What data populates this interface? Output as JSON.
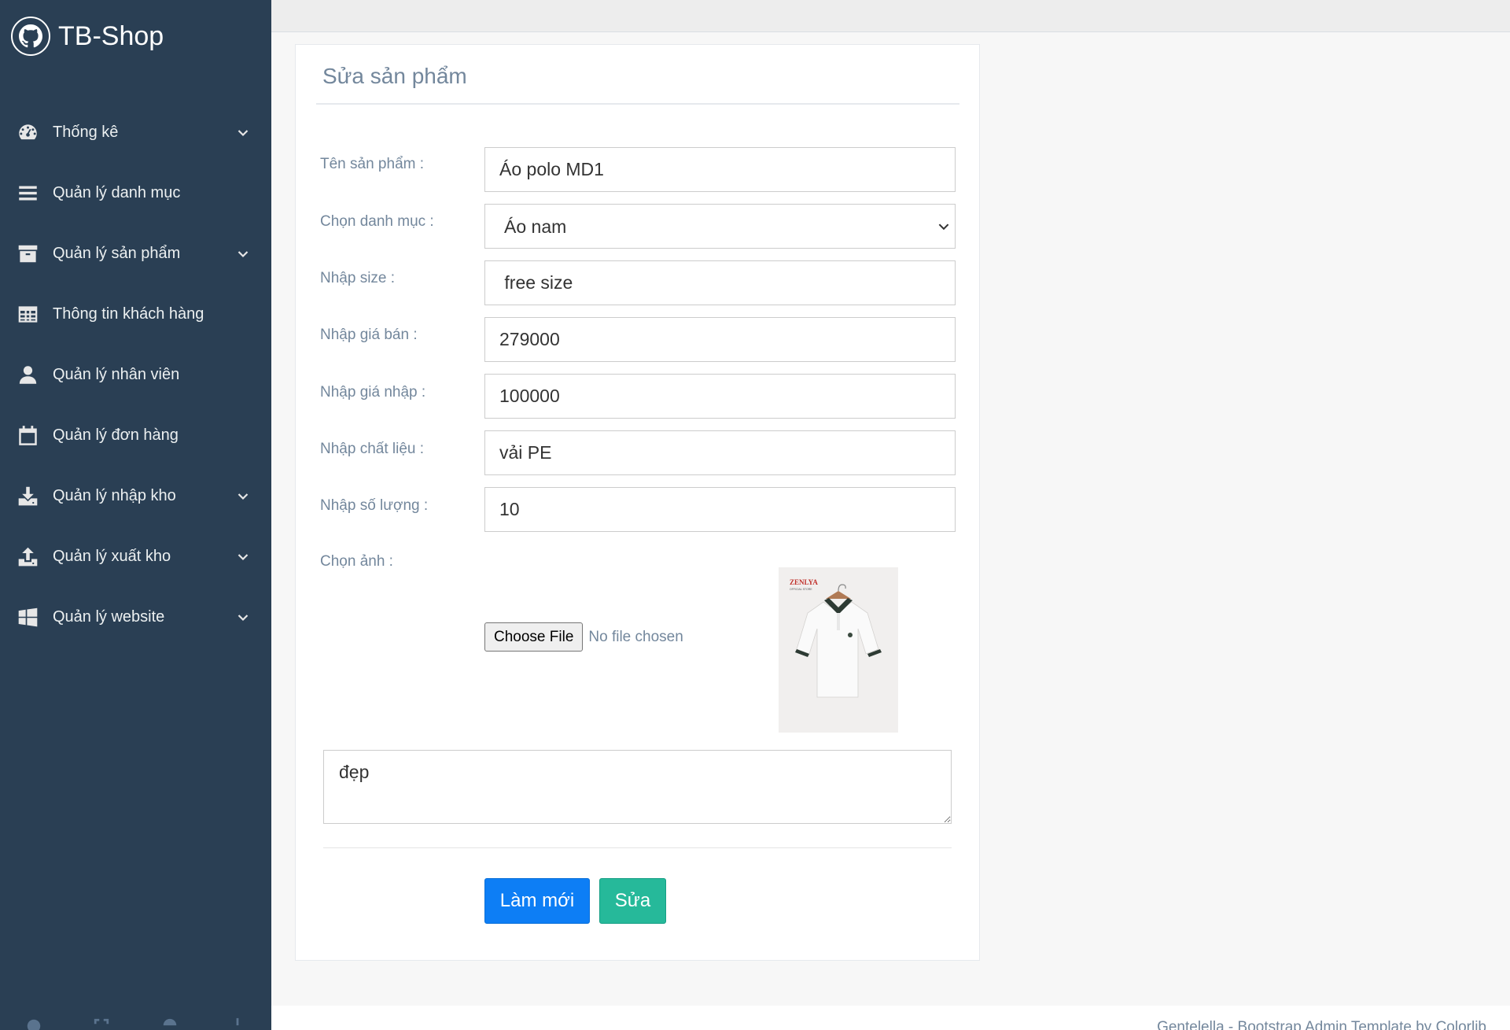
{
  "brand": {
    "title": "TB-Shop",
    "icon": "github-icon"
  },
  "sidebar": {
    "items": [
      {
        "label": "Thống kê",
        "icon": "dashboard-icon",
        "has_chevron": true
      },
      {
        "label": "Quản lý danh mục",
        "icon": "bars-icon",
        "has_chevron": false
      },
      {
        "label": "Quản lý sản phẩm",
        "icon": "archive-icon",
        "has_chevron": true
      },
      {
        "label": "Thông tin khách hàng",
        "icon": "table-icon",
        "has_chevron": false
      },
      {
        "label": "Quản lý nhân viên",
        "icon": "user-icon",
        "has_chevron": false
      },
      {
        "label": "Quản lý đơn hàng",
        "icon": "calendar-icon",
        "has_chevron": false
      },
      {
        "label": "Quản lý nhập kho",
        "icon": "download-icon",
        "has_chevron": true
      },
      {
        "label": "Quản lý xuất kho",
        "icon": "upload-icon",
        "has_chevron": true
      },
      {
        "label": "Quản lý website",
        "icon": "windows-icon",
        "has_chevron": true
      }
    ],
    "footer_icons": [
      "settings-icon",
      "fullscreen-icon",
      "lock-icon",
      "power-icon"
    ]
  },
  "form": {
    "title": "Sửa sản phẩm",
    "name_label": "Tên sản phẩm :",
    "name_value": "Áo polo MD1",
    "category_label": "Chọn danh mục :",
    "category_value": "Áo nam",
    "size_label": "Nhập size :",
    "size_value": " free size",
    "price_label": "Nhập giá bán :",
    "price_value": "279000",
    "cost_label": "Nhập giá nhập :",
    "cost_value": "100000",
    "material_label": "Nhập chất liệu :",
    "material_value": "vải PE",
    "quantity_label": "Nhập số lượng :",
    "quantity_value": "10",
    "image_label": "Chọn ảnh :",
    "file_button": "Choose File",
    "file_status": "No file chosen",
    "thumb_brand": "ZENLYA",
    "thumb_subtext": "OFFICIAL STORE",
    "description_value": "đẹp",
    "reset_button": "Làm mới",
    "submit_button": "Sửa"
  },
  "footer": {
    "text": "Gentelella - Bootstrap Admin Template by Colorlib"
  },
  "colors": {
    "sidebar_bg": "#2a3f54",
    "primary": "#0d7ef5",
    "success": "#26b99a",
    "label": "#73879c"
  }
}
